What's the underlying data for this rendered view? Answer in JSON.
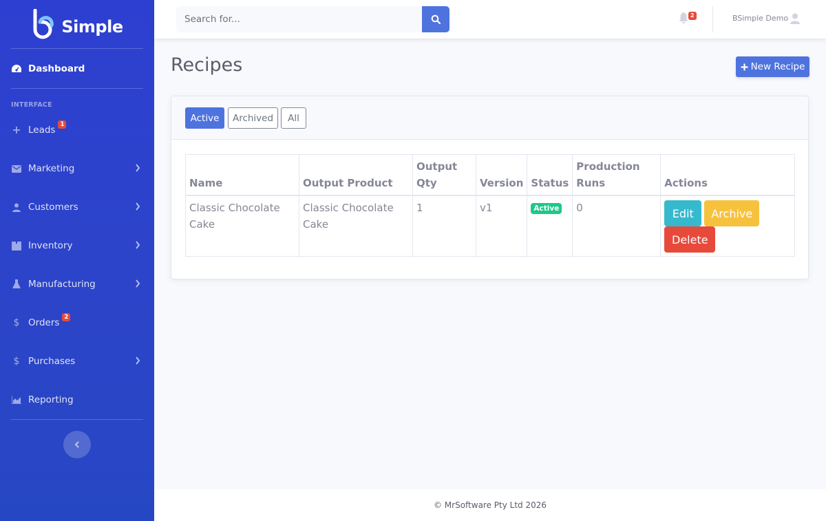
{
  "brand": {
    "name": "Simple"
  },
  "sidebar": {
    "dashboard": "Dashboard",
    "section_heading": "INTERFACE",
    "items": [
      {
        "label": "Leads",
        "badge": "1",
        "icon": "plus-icon"
      },
      {
        "label": "Marketing",
        "icon": "envelope-icon"
      },
      {
        "label": "Customers",
        "icon": "user-icon"
      },
      {
        "label": "Inventory",
        "icon": "box-icon"
      },
      {
        "label": "Manufacturing",
        "icon": "flask-icon"
      },
      {
        "label": "Orders",
        "badge": "2",
        "icon": "dollar-icon"
      },
      {
        "label": "Purchases",
        "icon": "dollar-icon"
      },
      {
        "label": "Reporting",
        "icon": "chart-area-icon"
      }
    ]
  },
  "topbar": {
    "search_placeholder": "Search for...",
    "alerts_count": "2",
    "user_name": "BSimple Demo"
  },
  "page": {
    "title": "Recipes",
    "new_button": "New Recipe"
  },
  "filters": {
    "active": "Active",
    "archived": "Archived",
    "all": "All"
  },
  "table": {
    "headers": {
      "name": "Name",
      "output_product": "Output Product",
      "output_qty": "Output Qty",
      "version": "Version",
      "status": "Status",
      "production_runs": "Production Runs",
      "actions": "Actions"
    },
    "rows": [
      {
        "name": "Classic Chocolate Cake",
        "output_product": "Classic Chocolate Cake",
        "output_qty": "1",
        "version": "v1",
        "status": "Active",
        "production_runs": "0",
        "actions": {
          "edit": "Edit",
          "archive": "Archive",
          "delete": "Delete"
        }
      }
    ]
  },
  "footer": {
    "text": "© MrSoftware Pty Ltd 2026"
  },
  "colors": {
    "primary": "#4e73df",
    "success": "#1cc88a",
    "info": "#36b9cc",
    "warning": "#f6c23e",
    "danger": "#e74a3b"
  }
}
